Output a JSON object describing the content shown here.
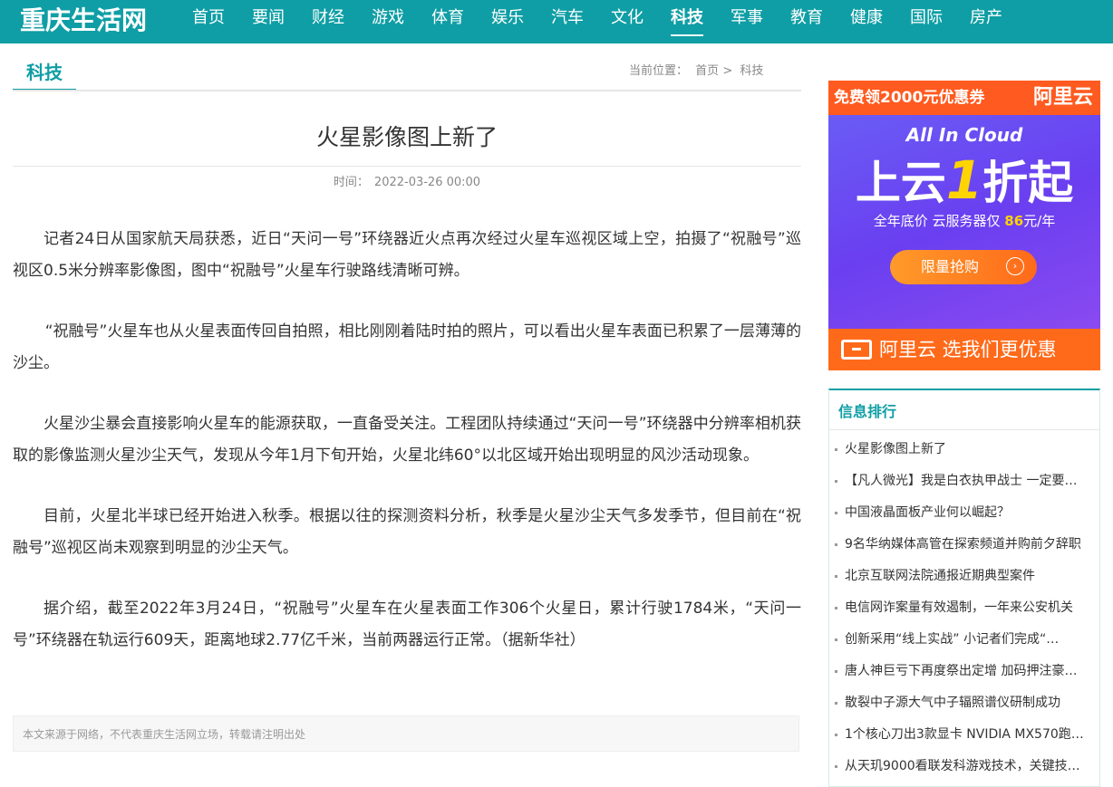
{
  "header": {
    "logo": "重庆生活网",
    "nav": [
      "首页",
      "要闻",
      "财经",
      "游戏",
      "体育",
      "娱乐",
      "汽车",
      "文化",
      "科技",
      "军事",
      "教育",
      "健康",
      "国际",
      "房产"
    ],
    "active_nav": "科技"
  },
  "section": {
    "title": "科技",
    "breadcrumb_label": "当前位置：",
    "breadcrumb_home": "首页",
    "breadcrumb_sep": ">",
    "breadcrumb_current": "科技"
  },
  "article": {
    "title": "火星影像图上新了",
    "time_label": "时间：",
    "time_value": "2022-03-26 00:00",
    "paragraphs": [
      "记者24日从国家航天局获悉，近日“天问一号”环绕器近火点再次经过火星车巡视区域上空，拍摄了“祝融号”巡视区0.5米分辨率影像图，图中“祝融号”火星车行驶路线清晰可辨。",
      "“祝融号”火星车也从火星表面传回自拍照，相比刚刚着陆时拍的照片，可以看出火星车表面已积累了一层薄薄的沙尘。",
      "火星沙尘暴会直接影响火星车的能源获取，一直备受关注。工程团队持续通过“天问一号”环绕器中分辨率相机获取的影像监测火星沙尘天气，发现从今年1月下旬开始，火星北纬60°以北区域开始出现明显的风沙活动现象。",
      "目前，火星北半球已经开始进入秋季。根据以往的探测资料分析，秋季是火星沙尘天气多发季节，但目前在“祝融号”巡视区尚未观察到明显的沙尘天气。",
      "据介绍，截至2022年3月24日，“祝融号”火星车在火星表面工作306个火星日，累计行驶1784米，“天问一号”环绕器在轨运行609天，距离地球2.77亿千米，当前两器运行正常。（据新华社）"
    ],
    "disclaimer": "本文来源于网络，不代表重庆生活网立场，转载请注明出处"
  },
  "ad": {
    "top_left": "免费领2000元优惠券",
    "top_right": "阿里云",
    "tagline": "All In Cloud",
    "headline_a": "上云",
    "headline_num": "1",
    "headline_b": "折起",
    "sub_a": "全年底价  云服务器仅 ",
    "sub_price": "86",
    "sub_b": "元/年",
    "button": "限量抢购",
    "bottom": "阿里云 选我们更优惠"
  },
  "ranking": {
    "title": "信息排行",
    "items": [
      "火星影像图上新了",
      "【凡人微光】我是白衣执甲战士 一定要…",
      "中国液晶面板产业何以崛起？",
      "9名华纳媒体高管在探索频道并购前夕辞职",
      "北京互联网法院通报近期典型案件",
      "电信网诈案量有效遏制，一年来公安机关",
      "创新采用“线上实战” 小记者们完成“…",
      "唐人神巨亏下再度祭出定增 加码押注豪…",
      "散裂中子源大气中子辐照谱仪研制成功",
      "1个核心刀出3款显卡 NVIDIA MX570跑…",
      "从天玑9000看联发科游戏技术，关键技…"
    ]
  }
}
